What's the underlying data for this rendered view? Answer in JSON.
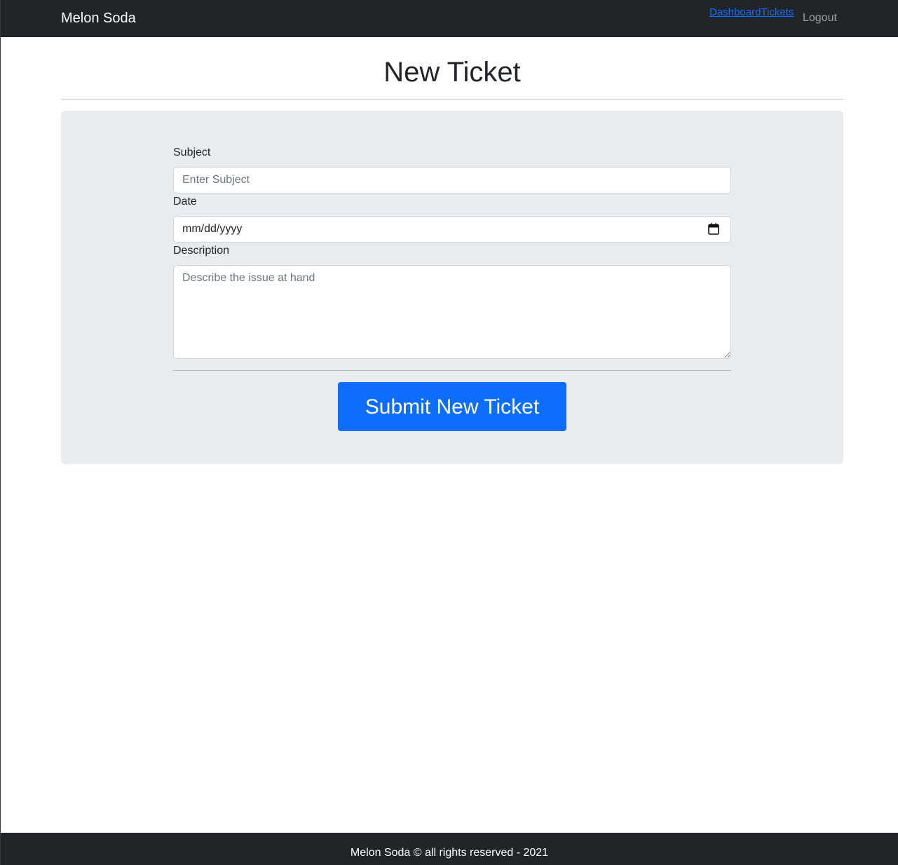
{
  "navbar": {
    "brand": "Melon Soda",
    "links": [
      {
        "label": "Dashboard"
      },
      {
        "label": "Tickets"
      }
    ],
    "logout_label": "Logout"
  },
  "page": {
    "title": "New Ticket"
  },
  "form": {
    "subject": {
      "label": "Subject",
      "placeholder": "Enter Subject",
      "value": ""
    },
    "date": {
      "label": "Date",
      "placeholder": "mm/dd/yyyy",
      "icon": "calendar-icon"
    },
    "description": {
      "label": "Description",
      "placeholder": "Describe the issue at hand",
      "value": ""
    },
    "submit_label": "Submit New Ticket"
  },
  "footer": {
    "text": "Melon Soda © all rights reserved - 2021"
  },
  "colors": {
    "navbar_bg": "#212529",
    "card_bg": "#e9ecef",
    "primary": "#0d6efd",
    "link": "#0d6efd"
  }
}
